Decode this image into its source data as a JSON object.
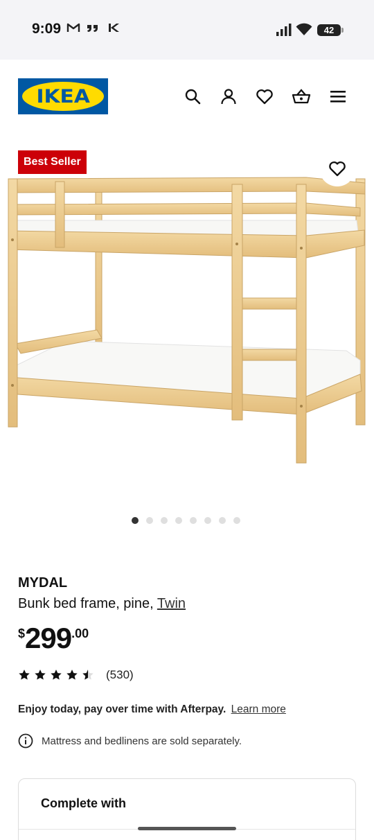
{
  "status_bar": {
    "time": "9:09",
    "battery": "42",
    "left_icons": [
      "gmail-icon",
      "quote-icon",
      "app-k-icon"
    ],
    "right_icons": [
      "signal-icon",
      "wifi-icon",
      "battery-icon"
    ]
  },
  "header": {
    "logo_text": "IKEA",
    "icons": [
      "search-icon",
      "account-icon",
      "favorites-icon",
      "cart-icon",
      "menu-icon"
    ],
    "colors": {
      "logo_blue": "#0058a3",
      "logo_yellow": "#ffdb00"
    }
  },
  "product": {
    "badge": "Best Seller",
    "badge_color": "#cc0008",
    "name": "MYDAL",
    "description": "Bunk bed frame, pine,",
    "size_link": "Twin",
    "price": {
      "currency": "$",
      "integer": "299",
      "decimal": ".00"
    },
    "rating": {
      "stars": 4.5,
      "max": 5,
      "count": "(530)"
    },
    "image_slides": {
      "count": 8,
      "active": 1
    }
  },
  "afterpay": {
    "text": "Enjoy today, pay over time with Afterpay.",
    "link": "Learn more"
  },
  "notice": {
    "text": "Mattress and bedlinens are sold separately."
  },
  "complete_with": {
    "title": "Complete with"
  }
}
